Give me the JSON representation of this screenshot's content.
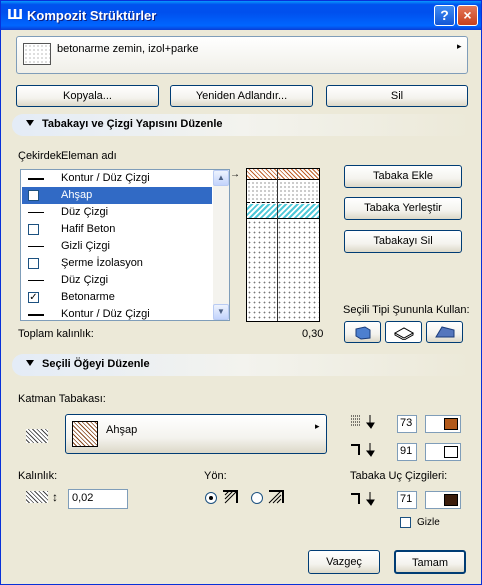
{
  "window": {
    "title": "Kompozit Strüktürler",
    "help_label": "?",
    "close_label": "×"
  },
  "selector": {
    "name": "betonarme zemin, izol+parke"
  },
  "top_buttons": {
    "copy": "Kopyala...",
    "rename": "Yeniden Adlandır...",
    "delete": "Sil"
  },
  "section1": {
    "title": "Tabakayı ve Çizgi Yapısını Düzenle"
  },
  "list_header": {
    "core": "Çekirdek",
    "name": "Eleman adı"
  },
  "layers": [
    {
      "type": "contour",
      "label": "Kontur /  Düz Çizgi",
      "selected": false
    },
    {
      "type": "checkbox",
      "label": "Ahşap",
      "checked": false,
      "selected": true
    },
    {
      "type": "line",
      "label": "Düz Çizgi",
      "selected": false
    },
    {
      "type": "checkbox",
      "label": "Hafif Beton",
      "checked": false,
      "selected": false
    },
    {
      "type": "line",
      "label": "Gizli Çizgi",
      "selected": false
    },
    {
      "type": "checkbox",
      "label": "Şerme İzolasyon",
      "checked": false,
      "selected": false
    },
    {
      "type": "line",
      "label": "Düz Çizgi",
      "selected": false
    },
    {
      "type": "checkbox",
      "label": "Betonarme",
      "checked": true,
      "selected": false
    },
    {
      "type": "contour",
      "label": "Kontur /  Düz Çizgi",
      "selected": false
    }
  ],
  "total": {
    "label": "Toplam kalınlık:",
    "value": "0,30"
  },
  "layer_buttons": {
    "add": "Tabaka Ekle",
    "insert": "Tabaka Yerleştir",
    "delete": "Tabakayı Sil"
  },
  "use_type": {
    "label": "Seçili Tipi Şununla Kullan:"
  },
  "section2": {
    "title": "Seçili Öğeyi Düzenle"
  },
  "material": {
    "label": "Katman Tabakası:",
    "value": "Ahşap"
  },
  "pens": {
    "fill_pen": "73",
    "bg_pen": "91",
    "end_pen": "71"
  },
  "thickness": {
    "label": "Kalınlık:",
    "value": "0,02"
  },
  "direction": {
    "label": "Yön:"
  },
  "end_lines": {
    "label": "Tabaka Uç Çizgileri:",
    "hide_label": "Gizle"
  },
  "footer": {
    "cancel": "Vazgeç",
    "ok": "Tamam"
  },
  "colors": {
    "pen73": "#b35a1a",
    "pen71": "#3b1d0c",
    "selection": "#316ac5"
  }
}
